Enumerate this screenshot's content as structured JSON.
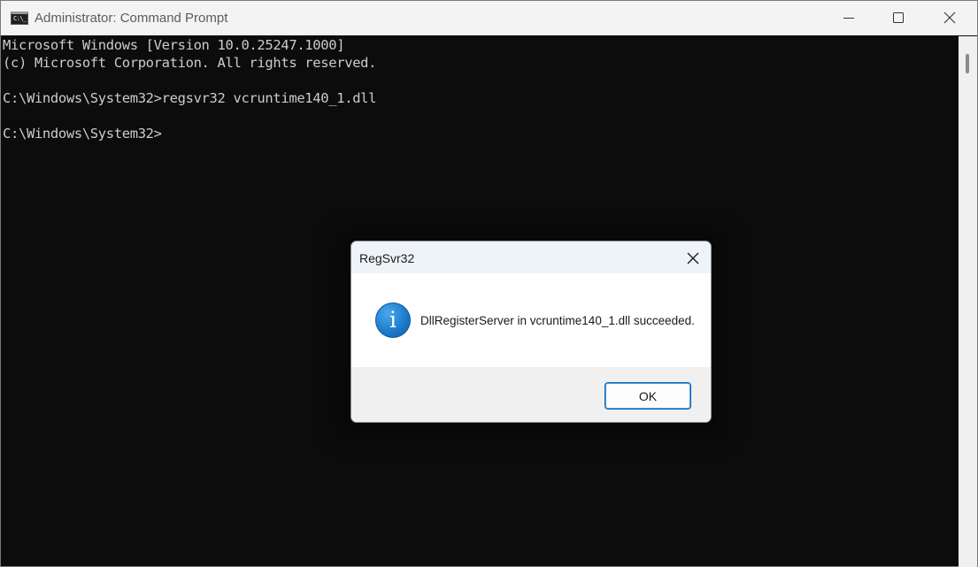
{
  "window": {
    "title": "Administrator: Command Prompt",
    "icon": "cmd-icon",
    "icon_text": "C:\\_",
    "controls": [
      "minimize-icon",
      "maximize-icon",
      "close-icon"
    ]
  },
  "console": {
    "lines": [
      "Microsoft Windows [Version 10.0.25247.1000]",
      "(c) Microsoft Corporation. All rights reserved.",
      "",
      "C:\\Windows\\System32>regsvr32 vcruntime140_1.dll",
      "",
      "C:\\Windows\\System32>"
    ]
  },
  "dialog": {
    "title": "RegSvr32",
    "icon": "info-icon",
    "icon_glyph": "i",
    "message": "DllRegisterServer in vcruntime140_1.dll succeeded.",
    "ok_label": "OK"
  },
  "colors": {
    "console_bg": "#0c0c0c",
    "console_text": "#cccccc",
    "titlebar_bg": "#f3f3f3",
    "accent": "#0067c0"
  }
}
